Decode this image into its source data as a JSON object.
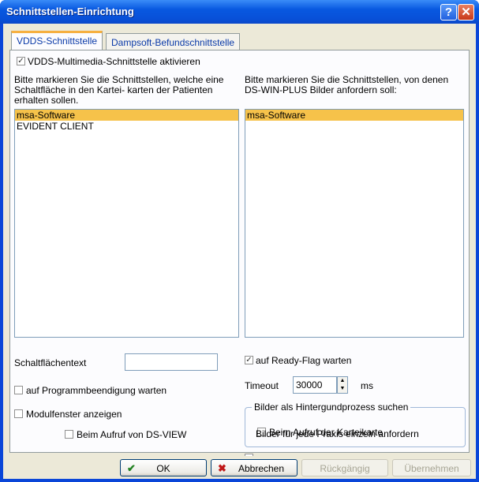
{
  "window": {
    "title": "Schnittstellen-Einrichtung",
    "help_glyph": "?",
    "close_glyph": "✕"
  },
  "tabs": [
    {
      "label": "VDDS-Schnittstelle",
      "active": true
    },
    {
      "label": "Dampsoft-Befundschnittstelle",
      "active": false
    }
  ],
  "vdds": {
    "activate_label": "VDDS-Multimedia-Schnittstelle aktivieren",
    "activate_checked": true,
    "left_desc_1": "Bitte markieren Sie die Schnittstellen, welche eine",
    "left_desc_2": "Schaltfläche in den Kartei- karten der Patienten",
    "left_desc_3": "erhalten sollen.",
    "right_desc_1": "Bitte markieren Sie die Schnittstellen, von denen",
    "right_desc_2": "DS-WIN-PLUS Bilder anfordern soll:",
    "left_list": [
      "msa-Software",
      "EVIDENT CLIENT"
    ],
    "right_list": [
      "msa-Software"
    ]
  },
  "options": {
    "button_text_label": "Schaltflächentext",
    "button_text_value": "",
    "wait_end_label": "auf Programmbeendigung warten",
    "wait_end_checked": false,
    "module_window_label": "Modulfenster anzeigen",
    "module_window_checked": false,
    "dsview_label": "Beim Aufruf von DS-VIEW",
    "dsview_checked": false,
    "ready_flag_label": "auf Ready-Flag warten",
    "ready_flag_checked": true,
    "timeout_label": "Timeout",
    "timeout_value": "30000",
    "timeout_unit": "ms",
    "background_group_label": "Bilder als Hintergundprozess suchen",
    "karteikarte_label": "Beim Aufruf der Karteikarte",
    "karteikarte_checked": false,
    "per_praxis_label": "Bilder für jede Praxis einzeln anfordern",
    "per_praxis_checked": false
  },
  "footer": {
    "ok_label": "OK",
    "cancel_label": "Abbrechen",
    "undo_label": "Rückgängig",
    "apply_label": "Übernehmen"
  },
  "colors": {
    "title_bar": "#0858e0",
    "selection": "#f6c24a",
    "ok_check": "#208020",
    "cancel_x": "#c01818"
  }
}
